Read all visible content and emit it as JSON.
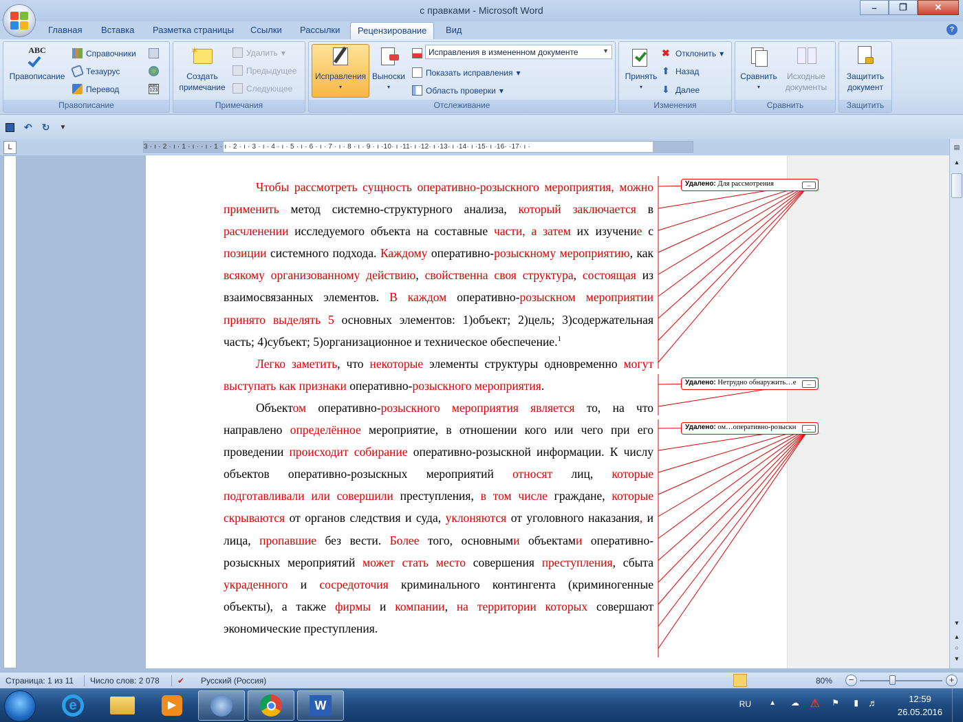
{
  "window": {
    "title": "с правками - Microsoft Word"
  },
  "tabs": [
    "Главная",
    "Вставка",
    "Разметка страницы",
    "Ссылки",
    "Рассылки",
    "Рецензирование",
    "Вид"
  ],
  "ribbon": {
    "spelling": {
      "label": "Правописание",
      "group": "Правописание",
      "items": [
        "Справочники",
        "Тезаурус",
        "Перевод"
      ],
      "abc": "ABC"
    },
    "comments": {
      "create": "Создать\nпримечание",
      "delete": "Удалить",
      "prev": "Предыдущее",
      "next": "Следующее",
      "group": "Примечания"
    },
    "tracking": {
      "track": "Исправления",
      "balloons": "Выноски",
      "dropdown": "Исправления в измененном документе",
      "show": "Показать исправления",
      "pane": "Область проверки",
      "group": "Отслеживание"
    },
    "changes": {
      "accept": "Принять",
      "reject": "Отклонить",
      "back": "Назад",
      "next": "Далее",
      "group": "Изменения"
    },
    "compare": {
      "compare": "Сравнить",
      "source": "Исходные\nдокументы",
      "group": "Сравнить"
    },
    "protect": {
      "protect": "Защитить\nдокумент",
      "group": "Защитить"
    }
  },
  "ruler": {
    "h": "3 · ı · 2 · ı · 1 · ı ·   · ı · 1 · ı · 2 · ı · 3 · ı · 4 · ı · 5 · ı · 6 · ı · 7 · ı · 8 · ı · 9 · ı ·10· ı ·11· ı ·12· ı ·13· ı ·14· ı ·15· ı ·16·   ·17· ı ·",
    "corner": "L",
    "v": [
      "2",
      "1",
      "1",
      "2",
      "3",
      "4",
      "5",
      "6",
      "7",
      "8",
      "9",
      "10",
      "11",
      "12",
      "13",
      "14",
      "15",
      "16",
      "17",
      "18",
      "19"
    ]
  },
  "document": {
    "p1": [
      {
        "t": "Чтобы рассмотреть сущность оперативно-розыскного мероприятия, можно применить",
        "r": true
      },
      {
        "t": " метод системно-структурного анализа, ",
        "r": false
      },
      {
        "t": "который заключается",
        "r": true
      },
      {
        "t": " в ",
        "r": false
      },
      {
        "t": "расчленении",
        "r": true
      },
      {
        "t": " исследуемого объекта на составные ",
        "r": false
      },
      {
        "t": "части, а затем",
        "r": true
      },
      {
        "t": " их изучени",
        "r": false
      },
      {
        "t": "е",
        "r": true
      },
      {
        "t": " с ",
        "r": false
      },
      {
        "t": "позиции",
        "r": true
      },
      {
        "t": " системного подхода. ",
        "r": false
      },
      {
        "t": "Каждому",
        "r": true
      },
      {
        "t": " оперативно-",
        "r": false
      },
      {
        "t": "розыскному мероприятию",
        "r": true
      },
      {
        "t": ", как ",
        "r": false
      },
      {
        "t": "всякому организованному действию",
        "r": true
      },
      {
        "t": ", ",
        "r": false
      },
      {
        "t": "свойственна своя структура",
        "r": true
      },
      {
        "t": ", ",
        "r": false
      },
      {
        "t": "состоящая",
        "r": true
      },
      {
        "t": " из взаимосвязанных элементов. ",
        "r": false
      },
      {
        "t": "В каждом",
        "r": true
      },
      {
        "t": " оперативно-",
        "r": false
      },
      {
        "t": "розыскном мероприятии принято выделять 5",
        "r": true
      },
      {
        "t": " основных элементов: 1)объект; 2)цель; 3)содержательная часть; 4)субъект; 5)организационное и техническое обеспечение.",
        "r": false
      }
    ],
    "p1_footnote": "1",
    "p2": [
      {
        "t": "Легко заметить",
        "r": true
      },
      {
        "t": ", что ",
        "r": false
      },
      {
        "t": "некоторые",
        "r": true
      },
      {
        "t": " элементы структуры одновременно ",
        "r": false
      },
      {
        "t": "могут выступать как признаки",
        "r": true
      },
      {
        "t": " оперативно-",
        "r": false
      },
      {
        "t": "розыскного мероприятия",
        "r": true
      },
      {
        "t": ".",
        "r": false
      }
    ],
    "p3": [
      {
        "t": "Объект",
        "r": false
      },
      {
        "t": "ом",
        "r": true
      },
      {
        "t": " оперативно-",
        "r": false
      },
      {
        "t": "розыскного мероприятия является",
        "r": true
      },
      {
        "t": " то, на что направлено ",
        "r": false
      },
      {
        "t": "определённое",
        "r": true
      },
      {
        "t": " мероприятие, в отношении кого или чего при его проведении ",
        "r": false
      },
      {
        "t": "происходит собирание",
        "r": true
      },
      {
        "t": " оперативно-розыскной информации. К числу объектов оперативно-розыскных мероприятий ",
        "r": false
      },
      {
        "t": "относят",
        "r": true
      },
      {
        "t": " лиц, ",
        "r": false
      },
      {
        "t": "которые подготавливали или совершили",
        "r": true
      },
      {
        "t": " преступления, ",
        "r": false
      },
      {
        "t": "в том числе",
        "r": true
      },
      {
        "t": " граждане, ",
        "r": false
      },
      {
        "t": "которые скрываются",
        "r": true
      },
      {
        "t": " от органов следствия и суда, ",
        "r": false
      },
      {
        "t": "уклоняются",
        "r": true
      },
      {
        "t": " от уголовного наказания",
        "r": false
      },
      {
        "t": ",",
        "r": true
      },
      {
        "t": " и лица, ",
        "r": false
      },
      {
        "t": "пропавшие",
        "r": true
      },
      {
        "t": " без вести. ",
        "r": false
      },
      {
        "t": "Более",
        "r": true
      },
      {
        "t": " того, основным",
        "r": false
      },
      {
        "t": "и",
        "r": true
      },
      {
        "t": " объектам",
        "r": false
      },
      {
        "t": "и",
        "r": true
      },
      {
        "t": " оперативно-розыскных мероприятий ",
        "r": false
      },
      {
        "t": "может стать место",
        "r": true
      },
      {
        "t": " совершения ",
        "r": false
      },
      {
        "t": "преступления",
        "r": true
      },
      {
        "t": ", сбыта ",
        "r": false
      },
      {
        "t": "украденного",
        "r": true
      },
      {
        "t": " и ",
        "r": false
      },
      {
        "t": "сосредоточия",
        "r": true
      },
      {
        "t": " криминального контингента (криминогенные объекты), а также ",
        "r": false
      },
      {
        "t": "фирмы",
        "r": true
      },
      {
        "t": " и ",
        "r": false
      },
      {
        "t": "компании",
        "r": true
      },
      {
        "t": ", ",
        "r": false
      },
      {
        "t": "на территории которых",
        "r": true
      },
      {
        "t": " совершают экономические преступления.",
        "r": false
      }
    ]
  },
  "balloons": [
    {
      "label": "Удалено:",
      "text": "Для рассмотрения"
    },
    {
      "label": "Удалено:",
      "text": "Нетрудно обнаружить…е"
    },
    {
      "label": "Удалено:",
      "text": "ом…оперативно-розыскн"
    }
  ],
  "balloon_more": "...",
  "status": {
    "page": "Страница: 1 из 11",
    "words": "Число слов: 2 078",
    "lang": "Русский (Россия)",
    "zoom": "80%"
  },
  "taskbar": {
    "lang": "RU",
    "time": "12:59",
    "date": "26.05.2016"
  },
  "colors": {
    "revision": "#e00000",
    "accent": "#15428b"
  }
}
